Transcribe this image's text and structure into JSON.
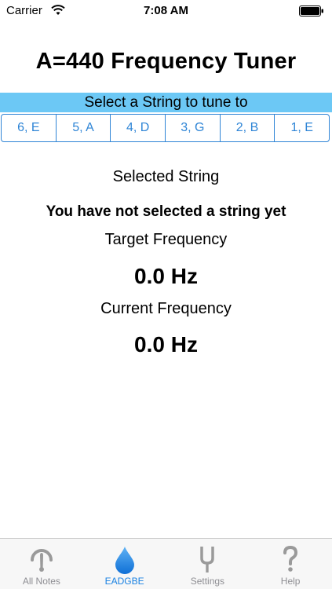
{
  "status_bar": {
    "carrier": "Carrier",
    "time": "7:08 AM"
  },
  "app": {
    "title": "A=440 Frequency Tuner"
  },
  "select_banner": "Select a String to tune to",
  "strings": [
    {
      "label": "6, E"
    },
    {
      "label": "5, A"
    },
    {
      "label": "4, D"
    },
    {
      "label": "3, G"
    },
    {
      "label": "2, B"
    },
    {
      "label": "1, E"
    }
  ],
  "content": {
    "selected_string_label": "Selected String",
    "selected_string_value": "You have not selected a string yet",
    "target_frequency_label": "Target Frequency",
    "target_frequency_value": "0.0 Hz",
    "current_frequency_label": "Current Frequency",
    "current_frequency_value": "0.0 Hz"
  },
  "tabs": [
    {
      "label": "All Notes",
      "icon": "gauge-icon"
    },
    {
      "label": "EADGBE",
      "icon": "drop-icon",
      "active": true
    },
    {
      "label": "Settings",
      "icon": "tuning-fork-icon"
    },
    {
      "label": "Help",
      "icon": "question-icon"
    }
  ],
  "colors": {
    "banner": "#6cc8f5",
    "accent": "#2f85d6",
    "tab_active": "#1a82e2",
    "tab_inactive": "#8e8e93"
  }
}
